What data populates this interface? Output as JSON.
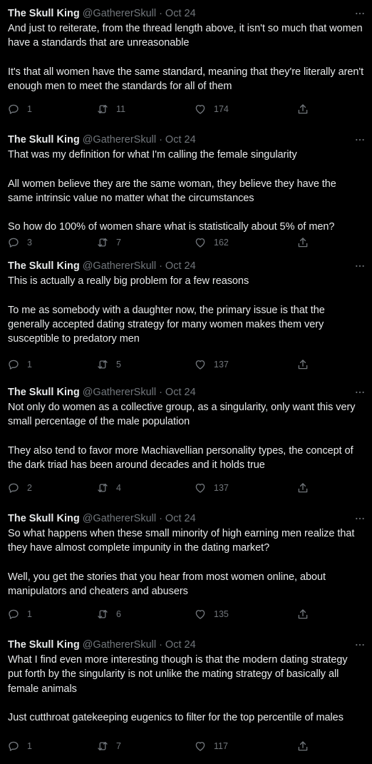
{
  "author": {
    "name": "The Skull King",
    "handle": "@GathererSkull",
    "separator": "·"
  },
  "icons": {
    "more": "more-dots-icon",
    "reply": "reply-bubble-icon",
    "retweet": "retweet-icon",
    "like": "heart-icon",
    "share": "share-upload-icon"
  },
  "colors": {
    "background": "#000000",
    "text": "#e7e9ea",
    "muted": "#71767b"
  },
  "tweets": [
    {
      "date": "Oct 24",
      "text": "And just to reiterate, from the thread length above, it isn't so much that women have a standards that are unreasonable\n\nIt's that all women have the same standard, meaning that they're literally aren't enough men to meet the standards for all of them",
      "replies": "1",
      "retweets": "11",
      "likes": "174"
    },
    {
      "date": "Oct 24",
      "text": "That was my definition for what I'm calling the female singularity\n\nAll women believe they are the same woman, they believe they have the same intrinsic value no matter what the circumstances\n\nSo how do 100% of women share what is statistically about 5% of men?",
      "replies": "3",
      "retweets": "7",
      "likes": "162"
    },
    {
      "date": "Oct 24",
      "text": "This is actually a really big problem for a few reasons\n\nTo me as somebody with a daughter now, the primary issue is that the generally accepted dating strategy for many women makes them very susceptible to predatory men",
      "replies": "1",
      "retweets": "5",
      "likes": "137"
    },
    {
      "date": "Oct 24",
      "text": "Not only do women as a collective group, as a singularity, only want this very small percentage of the male population\n\nThey also tend to favor more Machiavellian personality types, the concept of the dark triad has been around decades and it holds true",
      "replies": "2",
      "retweets": "4",
      "likes": "137"
    },
    {
      "date": "Oct 24",
      "text": "So what happens when these small minority of high earning men realize that they have almost complete impunity in the dating market?\n\nWell, you get the stories that you hear from most women online, about manipulators and cheaters and abusers",
      "replies": "1",
      "retweets": "6",
      "likes": "135"
    },
    {
      "date": "Oct 24",
      "text": "What I find even more interesting though is that the modern dating strategy put forth by the singularity is not unlike the mating strategy of basically all female animals\n\nJust cutthroat gatekeeping eugenics to filter for the top percentile of males",
      "replies": "1",
      "retweets": "7",
      "likes": "117"
    }
  ]
}
